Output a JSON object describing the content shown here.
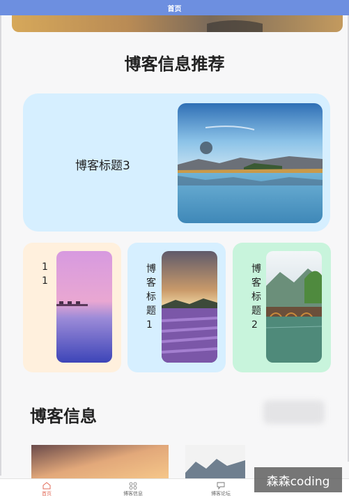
{
  "header": {
    "title": "首页"
  },
  "recommend": {
    "title": "博客信息推荐",
    "big_card": {
      "label": "博客标题3"
    },
    "small_cards": [
      {
        "label": "11"
      },
      {
        "label": "博客标题1"
      },
      {
        "label": "博客标题2"
      }
    ]
  },
  "info": {
    "title": "博客信息"
  },
  "tabs": [
    {
      "label": "首页",
      "icon": "home-icon",
      "active": true
    },
    {
      "label": "博客信息",
      "icon": "grid-icon",
      "active": false
    },
    {
      "label": "博客论坛",
      "icon": "chat-icon",
      "active": false
    }
  ],
  "watermark": "森森coding",
  "colors": {
    "header": "#6d8fe0",
    "active_tab": "#e26a57",
    "card_blue": "#d6efff",
    "card_peach": "#fff0dd",
    "card_mint": "#c8f4dc"
  }
}
